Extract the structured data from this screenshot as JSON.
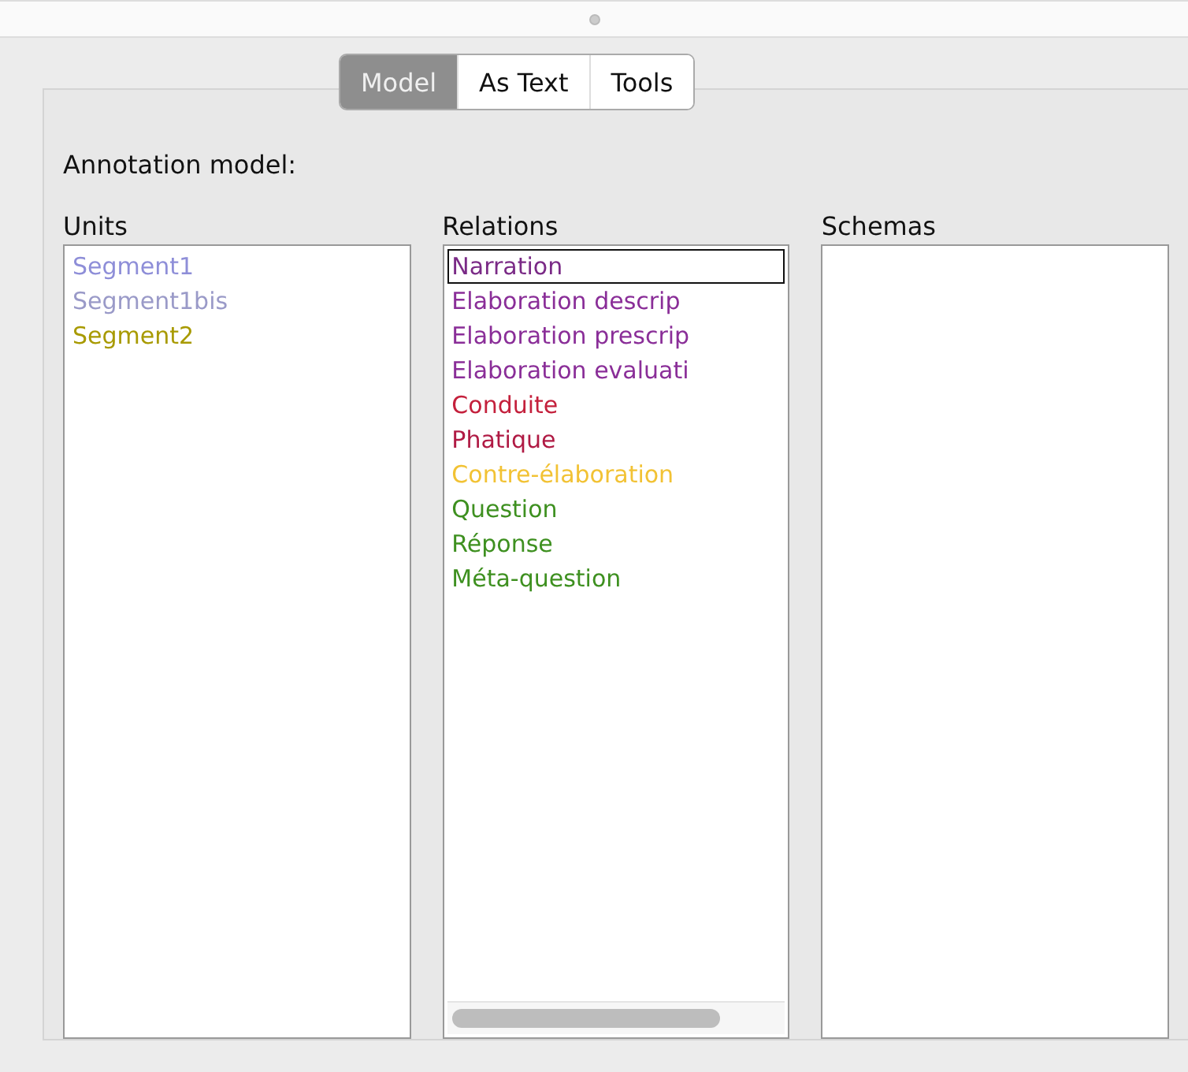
{
  "tabs": [
    {
      "label": "Model",
      "selected": true
    },
    {
      "label": "As Text",
      "selected": false
    },
    {
      "label": "Tools",
      "selected": false
    }
  ],
  "heading": "Annotation model:",
  "units": {
    "title": "Units",
    "items": [
      {
        "label": "Segment1",
        "color": "#8e8ed8",
        "selected": false
      },
      {
        "label": "Segment1bis",
        "color": "#9a9ac8",
        "selected": false
      },
      {
        "label": "Segment2",
        "color": "#a89a00",
        "selected": false
      }
    ]
  },
  "relations": {
    "title": "Relations",
    "items": [
      {
        "label": "Narration",
        "color": "#7a2a86",
        "selected": true
      },
      {
        "label": "Elaboration descrip",
        "color": "#8a2e98",
        "selected": false
      },
      {
        "label": "Elaboration prescrip",
        "color": "#8a2e98",
        "selected": false
      },
      {
        "label": "Elaboration evaluati",
        "color": "#8a2e98",
        "selected": false
      },
      {
        "label": "Conduite",
        "color": "#c4203c",
        "selected": false
      },
      {
        "label": "Phatique",
        "color": "#b01a44",
        "selected": false
      },
      {
        "label": "Contre-élaboration",
        "color": "#f2c234",
        "selected": false
      },
      {
        "label": "Question",
        "color": "#3e9020",
        "selected": false
      },
      {
        "label": "Réponse",
        "color": "#3e9020",
        "selected": false
      },
      {
        "label": "Méta-question",
        "color": "#3e9020",
        "selected": false
      }
    ]
  },
  "schemas": {
    "title": "Schemas"
  }
}
